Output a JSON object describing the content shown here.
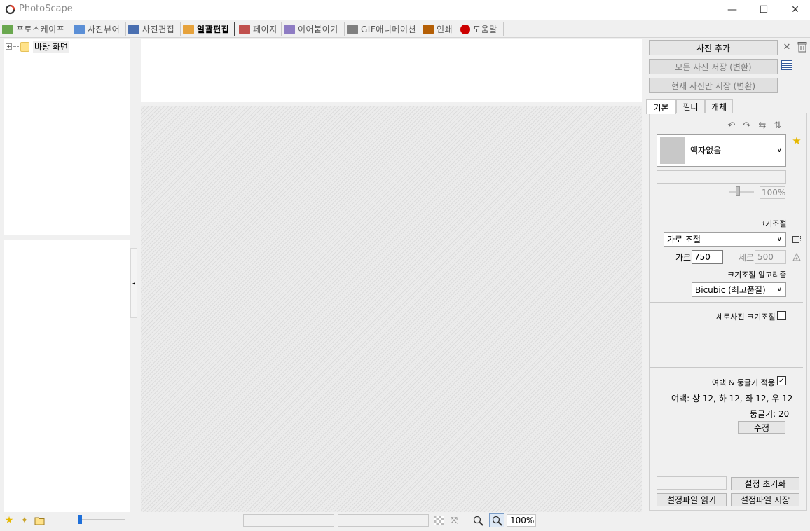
{
  "window": {
    "title": "PhotoScape",
    "minimize": "—",
    "maximize": "☐",
    "close": "✕"
  },
  "tabs": [
    {
      "label": "포토스케이프",
      "color": "#6aa84f"
    },
    {
      "label": "사진뷰어",
      "color": "#5b8fd6"
    },
    {
      "label": "사진편집",
      "color": "#4a6fb0"
    },
    {
      "label": "일괄편집",
      "color": "#e6a23c"
    },
    {
      "label": "페이지",
      "color": "#c0504d"
    },
    {
      "label": "이어붙이기",
      "color": "#8e7cc3"
    },
    {
      "label": "GIF애니메이션",
      "color": "#7f7f7f"
    },
    {
      "label": "인쇄",
      "color": "#b45f06"
    },
    {
      "label": "도움말",
      "color": "#cc0000"
    }
  ],
  "tree": {
    "root_label": "바탕 화면"
  },
  "right": {
    "add_photo": "사진 추가",
    "save_all": "모든 사진 저장 (변환)",
    "save_current": "현재 사진만 저장 (변환)",
    "tabs": [
      "기본",
      "필터",
      "개체"
    ],
    "frame_select": "액자없음",
    "frame_zoom": "100%",
    "resize_title": "크기조절",
    "resize_mode": "가로 조절",
    "width_label": "가로",
    "width_value": "750",
    "height_label": "세로",
    "height_value": "500",
    "algo_title": "크기조절 알고리즘",
    "algo_value": "Bicubic (최고품질)",
    "portrait_resize": "세로사진 크기조절",
    "margin_round_apply": "여백 & 둥글기 적용",
    "margin_text": "여백: 상 12, 하 12, 좌 12, 우 12",
    "round_text": "둥글기: 20",
    "edit_button": "수정",
    "reset_settings": "설정 초기화",
    "load_settings": "설정파일 읽기",
    "save_settings": "설정파일 저장"
  },
  "status": {
    "zoom": "100%"
  }
}
